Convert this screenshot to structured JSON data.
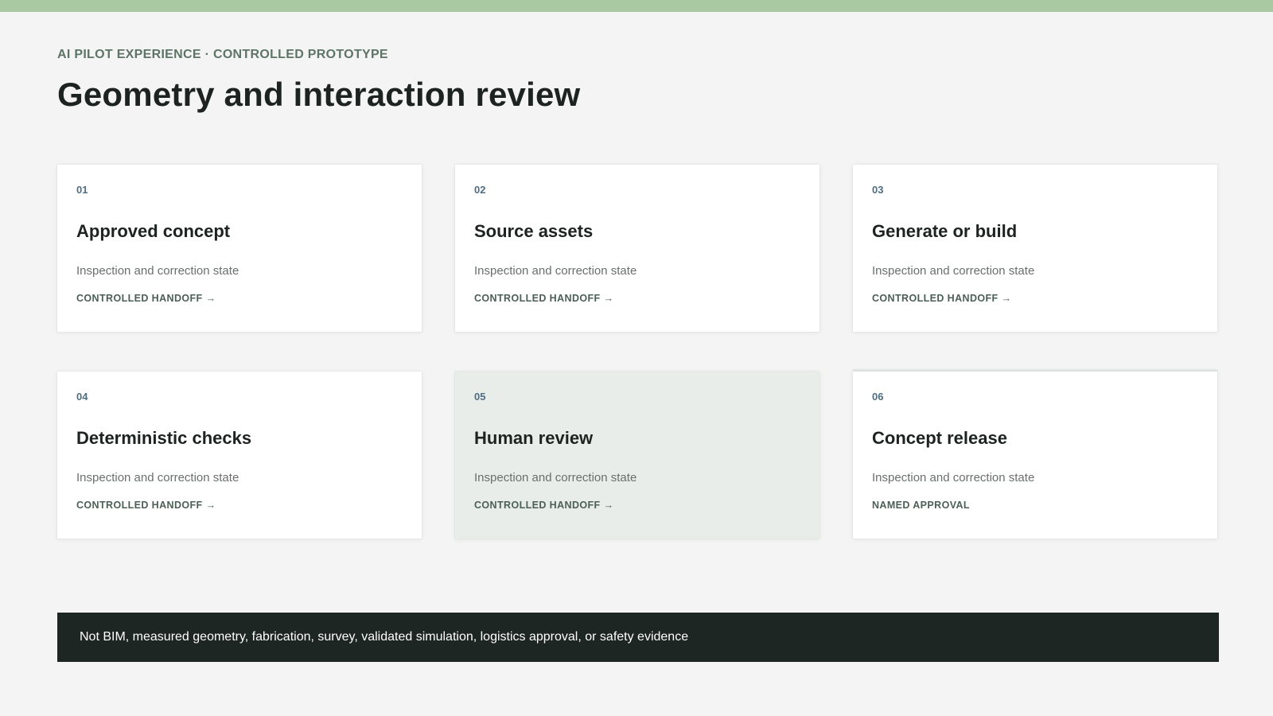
{
  "colors": {
    "accent_bar": "#a8c9a1",
    "eyebrow": "#5d7466",
    "number": "#4f6d83",
    "footer_bg": "#1e2624",
    "active_card_bg": "#e9edea"
  },
  "header": {
    "eyebrow": "AI PILOT EXPERIENCE · CONTROLLED PROTOTYPE",
    "title": "Geometry and interaction review"
  },
  "cards": [
    {
      "number": "01",
      "title": "Approved concept",
      "description": "Inspection and correction state",
      "action": "CONTROLLED HANDOFF",
      "arrow": "→"
    },
    {
      "number": "02",
      "title": "Source assets",
      "description": "Inspection and correction state",
      "action": "CONTROLLED HANDOFF",
      "arrow": "→"
    },
    {
      "number": "03",
      "title": "Generate or build",
      "description": "Inspection and correction state",
      "action": "CONTROLLED HANDOFF",
      "arrow": "→"
    },
    {
      "number": "04",
      "title": "Deterministic checks",
      "description": "Inspection and correction state",
      "action": "CONTROLLED HANDOFF",
      "arrow": "→"
    },
    {
      "number": "05",
      "title": "Human review",
      "description": "Inspection and correction state",
      "action": "CONTROLLED HANDOFF",
      "arrow": "→",
      "active": true
    },
    {
      "number": "06",
      "title": "Concept release",
      "description": "Inspection and correction state",
      "action": "NAMED APPROVAL",
      "arrow": ""
    }
  ],
  "footer": {
    "disclaimer": "Not BIM, measured geometry, fabrication, survey, validated simulation, logistics approval, or safety evidence"
  }
}
